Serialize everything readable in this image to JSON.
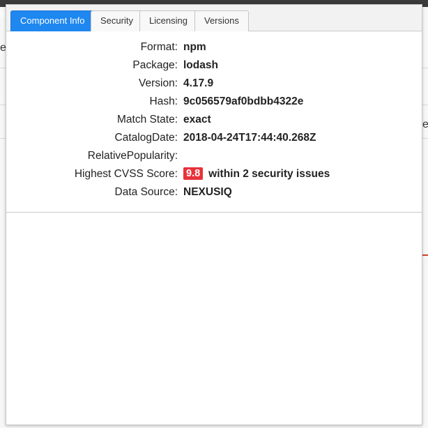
{
  "background": {
    "fragment_top_left": "e",
    "fragment_mid_left": "e",
    "fragment_mid_right": "ey"
  },
  "tabs": [
    {
      "label": "Component Info",
      "active": true
    },
    {
      "label": "Security",
      "active": false
    },
    {
      "label": "Licensing",
      "active": false
    },
    {
      "label": "Versions",
      "active": false
    }
  ],
  "component_info": {
    "rows": [
      {
        "label": "Format:",
        "value": "npm"
      },
      {
        "label": "Package:",
        "value": "lodash"
      },
      {
        "label": "Version:",
        "value": "4.17.9"
      },
      {
        "label": "Hash:",
        "value": "9c056579af0bdbb4322e"
      },
      {
        "label": "Match State:",
        "value": "exact"
      },
      {
        "label": "CatalogDate:",
        "value": "2018-04-24T17:44:40.268Z"
      },
      {
        "label": "RelativePopularity:",
        "value": ""
      },
      {
        "label": "Highest CVSS Score:",
        "score": "9.8",
        "value": "within 2 security issues"
      },
      {
        "label": "Data Source:",
        "value": "NEXUSIQ"
      }
    ]
  },
  "colors": {
    "active_tab": "#1e87f0",
    "score_badge": "#e8323a"
  }
}
